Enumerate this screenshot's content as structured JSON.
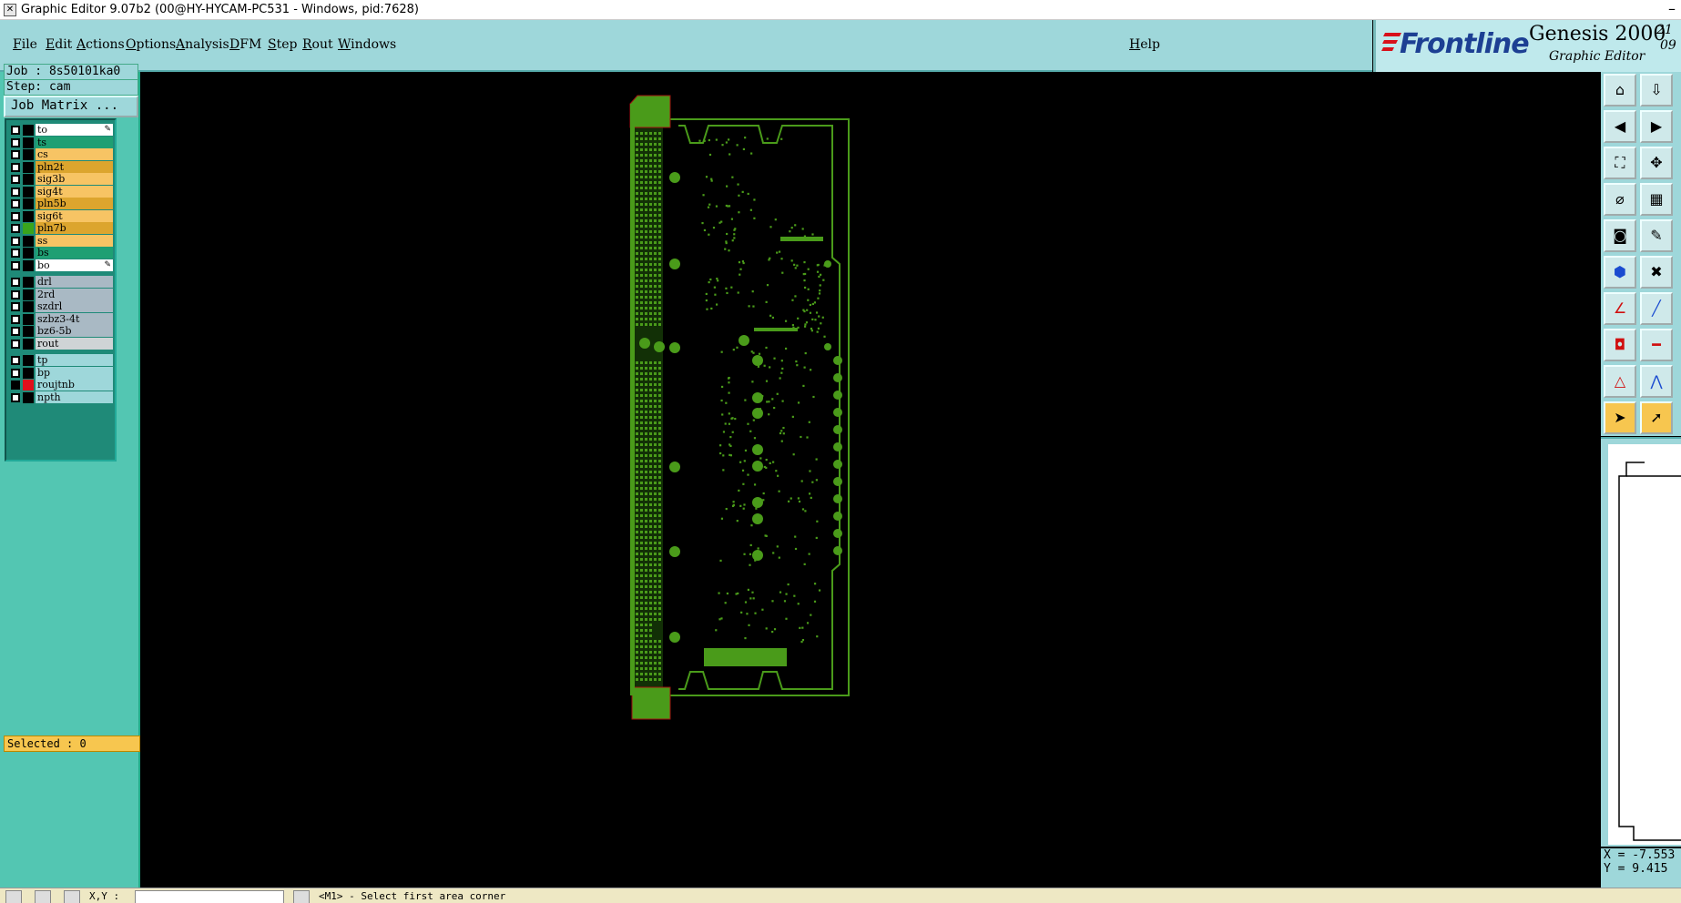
{
  "window": {
    "title": "Graphic Editor 9.07b2 (00@HY-HYCAM-PC531 - Windows, pid:7628)"
  },
  "menu": {
    "items": [
      "File",
      "Edit",
      "Actions",
      "Options",
      "Analysis",
      "DFM",
      "Step",
      "Rout",
      "Windows"
    ],
    "help": "Help"
  },
  "brand": {
    "logo": "Frontline",
    "product": "Genesis 2000",
    "subtitle": "Graphic Editor",
    "version_top": "21",
    "version_bottom": "09"
  },
  "job": {
    "job_label": "Job : 8s50101ka0",
    "step_label": "Step: cam",
    "matrix_button": "Job Matrix ..."
  },
  "layers": [
    {
      "name": "to",
      "color": "#ffffff",
      "checked": false,
      "editable": true,
      "swatch": "#000000"
    },
    {
      "name": "ts",
      "color": "#1f9f73",
      "checked": false,
      "swatch": "#000000"
    },
    {
      "name": "cs",
      "color": "#f7c464",
      "checked": false,
      "swatch": "#000000"
    },
    {
      "name": "pln2t",
      "color": "#dca52e",
      "checked": false,
      "swatch": "#000000"
    },
    {
      "name": "sig3b",
      "color": "#f7c464",
      "checked": false,
      "swatch": "#000000"
    },
    {
      "name": "sig4t",
      "color": "#f7c464",
      "checked": false,
      "swatch": "#000000"
    },
    {
      "name": "pln5b",
      "color": "#dca52e",
      "checked": false,
      "swatch": "#000000"
    },
    {
      "name": "sig6t",
      "color": "#f7c464",
      "checked": false,
      "swatch": "#000000"
    },
    {
      "name": "pln7b",
      "color": "#dca52e",
      "checked": false,
      "swatch": "#3aa51c"
    },
    {
      "name": "ss",
      "color": "#f7c464",
      "checked": false,
      "swatch": "#000000"
    },
    {
      "name": "bs",
      "color": "#1f9f73",
      "checked": false,
      "swatch": "#000000"
    },
    {
      "name": "bo",
      "color": "#ffffff",
      "checked": false,
      "editable": true,
      "swatch": "#000000"
    },
    {
      "name": "drl",
      "color": "#a9b9c4",
      "checked": false,
      "swatch": "#000000"
    },
    {
      "name": "2rd",
      "color": "#a9b9c4",
      "checked": false,
      "swatch": "#000000"
    },
    {
      "name": "szdrl",
      "color": "#a9b9c4",
      "checked": false,
      "swatch": "#000000"
    },
    {
      "name": "szbz3-4t",
      "color": "#a9b9c4",
      "checked": false,
      "swatch": "#000000"
    },
    {
      "name": "bz6-5b",
      "color": "#a9b9c4",
      "checked": false,
      "swatch": "#000000"
    },
    {
      "name": "rout",
      "color": "#cfd4d6",
      "checked": false,
      "swatch": "#000000"
    },
    {
      "name": "tp",
      "color": "#9ed7da",
      "checked": false,
      "swatch": "#000000"
    },
    {
      "name": "bp",
      "color": "#9ed7da",
      "checked": false,
      "swatch": "#000000"
    },
    {
      "name": "roujtnb",
      "color": "#9ed7da",
      "checked": true,
      "swatch": "#e0101b"
    },
    {
      "name": "npth",
      "color": "#9ed7da",
      "checked": false,
      "swatch": "#000000"
    }
  ],
  "selected": "Selected : 0",
  "coords": {
    "x": "X = -7.553",
    "y": "Y = 9.415"
  },
  "status": {
    "xy_label": "X,Y :",
    "prompt": "<M1> - Select first area corner"
  },
  "colors": {
    "board": "#4a9b1a",
    "panel": "#53c6b2",
    "menu": "#9ed7da",
    "highlight": "#f7c64f"
  }
}
